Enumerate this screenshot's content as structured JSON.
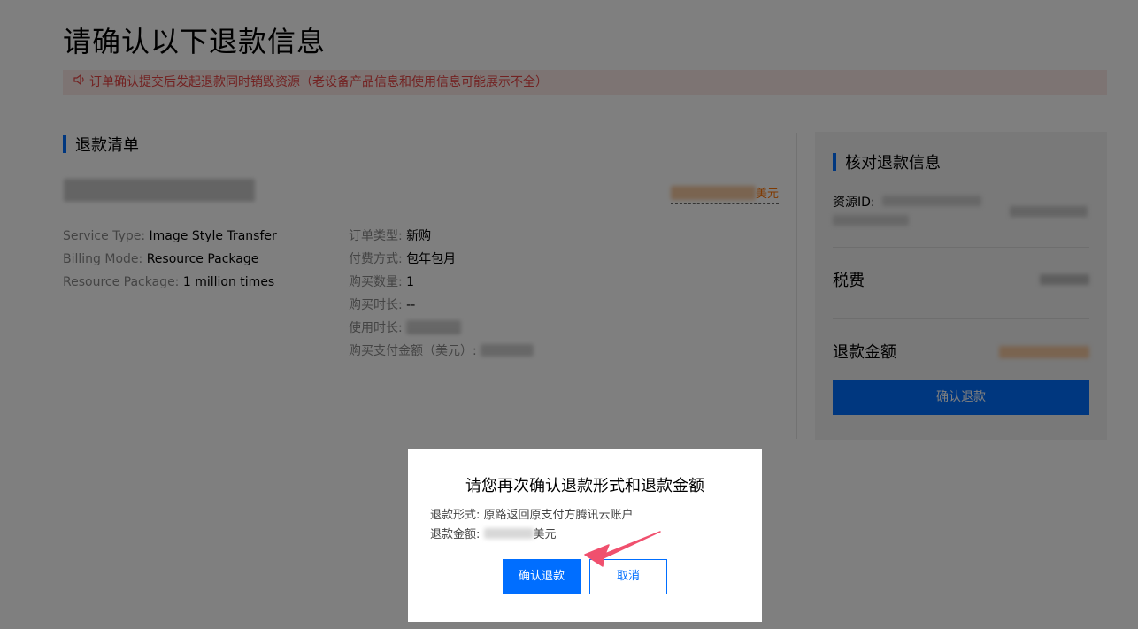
{
  "page": {
    "title": "请确认以下退款信息",
    "notice": "订单确认提交后发起退款同时销毁资源（老设备产品信息和使用信息可能展示不全）"
  },
  "refund_list": {
    "section_title": "退款清单",
    "price_unit": "美元",
    "left_rows": [
      {
        "label": "Service Type:",
        "value": "Image Style Transfer"
      },
      {
        "label": "Billing Mode:",
        "value": "Resource Package"
      },
      {
        "label": "Resource Package:",
        "value": "1 million times"
      }
    ],
    "right_rows": [
      {
        "label": "订单类型:",
        "value": "新购"
      },
      {
        "label": "付费方式:",
        "value": "包年包月"
      },
      {
        "label": "购买数量:",
        "value": "1"
      },
      {
        "label": "购买时长:",
        "value": "--"
      },
      {
        "label": "使用时长:",
        "value": ""
      },
      {
        "label": "购买支付金额（美元）:",
        "value": ""
      }
    ]
  },
  "verify_panel": {
    "title": "核对退款信息",
    "resource_id_label": "资源ID:",
    "tax_label": "税费",
    "refund_amount_label": "退款金额",
    "confirm_button": "确认退款"
  },
  "modal": {
    "title": "请您再次确认退款形式和退款金额",
    "refund_method_label": "退款形式:",
    "refund_method_value": "原路返回原支付方腾讯云账户",
    "refund_amount_label": "退款金额:",
    "refund_amount_unit": "美元",
    "ok_button": "确认退款",
    "cancel_button": "取消"
  },
  "colors": {
    "accent": "#006eff",
    "notice_bg": "#fbe9e7",
    "notice_text": "#e54545",
    "price": "#ff7200",
    "annotation_arrow": "#f0506e"
  }
}
